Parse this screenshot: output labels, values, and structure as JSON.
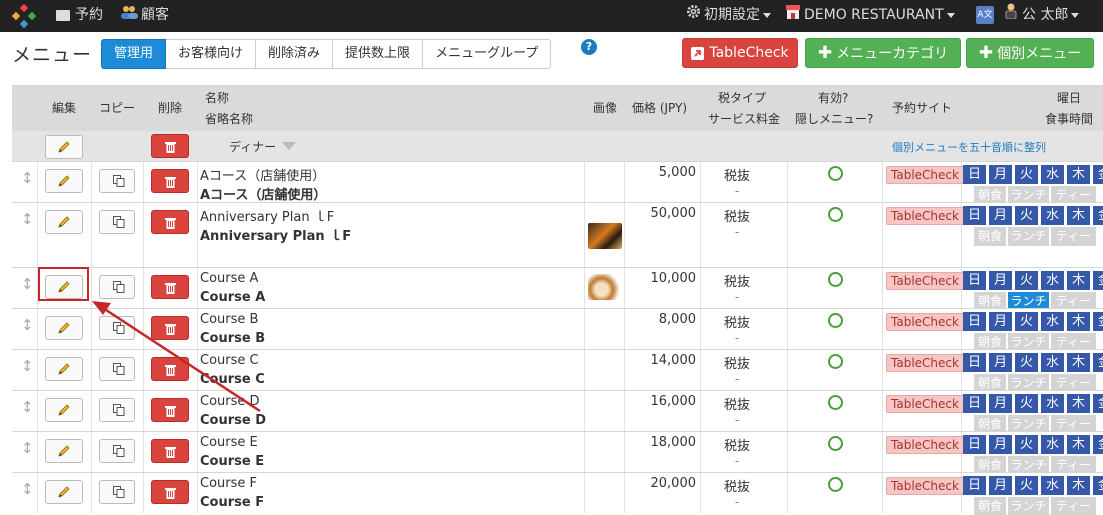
{
  "nav": {
    "reservations": "予約",
    "customers": "顧客",
    "settings": "初期設定",
    "restaurant": "DEMO RESTAURANT",
    "language_icon": "A文",
    "user": "公 太郎"
  },
  "page": {
    "title": "メニュー",
    "tabs": [
      {
        "label": "管理用"
      },
      {
        "label": "お客様向け"
      },
      {
        "label": "削除済み"
      },
      {
        "label": "提供数上限"
      },
      {
        "label": "メニューグループ"
      }
    ],
    "help": "?",
    "buttons": {
      "tablecheck": "TableCheck",
      "add_category": "メニューカテゴリ",
      "add_item": "個別メニュー"
    }
  },
  "table": {
    "headers": {
      "edit": "編集",
      "copy": "コピー",
      "delete": "削除",
      "name": "名称",
      "short_name": "省略名称",
      "image": "画像",
      "price": "価格 (JPY)",
      "tax_type": "税タイプ",
      "service_fee": "サービス料金",
      "active": "有効?",
      "hidden": "隠しメニュー?",
      "booking_sites": "予約サイト",
      "weekday": "曜日",
      "meal_time": "食事時間"
    },
    "category": "ディナー",
    "sort_link": "個別メニューを五十音順に整列",
    "days": [
      "日",
      "月",
      "火",
      "水",
      "木",
      "金"
    ],
    "meals": [
      "朝食",
      "ランチ",
      "ティー"
    ],
    "rows": [
      {
        "name": "Aコース（店舗使用）",
        "short": "Aコース（店舗使用）",
        "price": "5,000",
        "tax": "税抜",
        "service": "-",
        "site": "TableCheck",
        "active_meal": ""
      },
      {
        "name": "Anniversary Plan ｌF",
        "short": "Anniversary Plan ｌF",
        "price": "50,000",
        "tax": "税抜",
        "service": "-",
        "site": "TableCheck",
        "active_meal": ""
      },
      {
        "name": "Course A",
        "short": "Course A",
        "price": "10,000",
        "tax": "税抜",
        "service": "-",
        "site": "TableCheck",
        "active_meal": "ランチ"
      },
      {
        "name": "Course B",
        "short": "Course B",
        "price": "8,000",
        "tax": "税抜",
        "service": "-",
        "site": "TableCheck",
        "active_meal": ""
      },
      {
        "name": "Course C",
        "short": "Course C",
        "price": "14,000",
        "tax": "税抜",
        "service": "-",
        "site": "TableCheck",
        "active_meal": ""
      },
      {
        "name": "Course D",
        "short": "Course D",
        "price": "16,000",
        "tax": "税抜",
        "service": "-",
        "site": "TableCheck",
        "active_meal": ""
      },
      {
        "name": "Course E",
        "short": "Course E",
        "price": "18,000",
        "tax": "税抜",
        "service": "-",
        "site": "TableCheck",
        "active_meal": ""
      },
      {
        "name": "Course F",
        "short": "Course F",
        "price": "20,000",
        "tax": "税抜",
        "service": "-",
        "site": "TableCheck",
        "active_meal": ""
      }
    ]
  },
  "colors": {
    "topbar": "#222222",
    "primary": "#1d8bd8",
    "danger": "#d9443f",
    "success": "#54b054",
    "day_badge": "#3558a8",
    "annotation": "#c62828"
  }
}
